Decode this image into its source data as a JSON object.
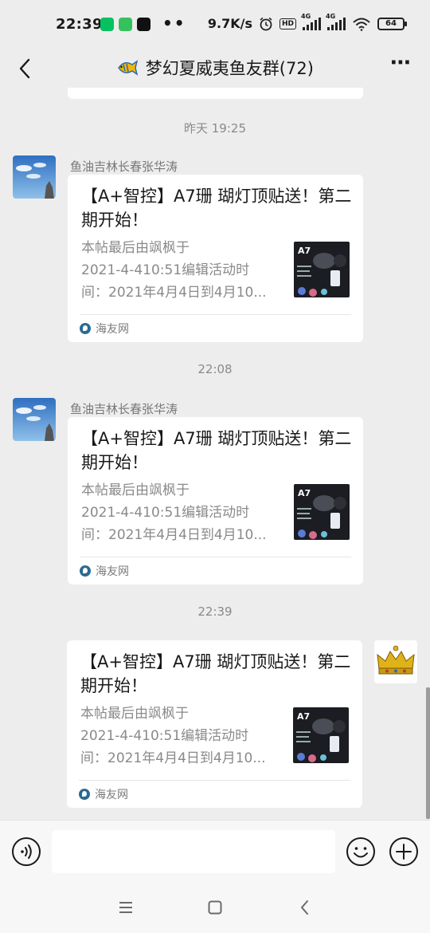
{
  "status_bar": {
    "time": "22:39",
    "dots": "••",
    "speed": "9.7K/s",
    "hd": "HD",
    "net1": "4G",
    "net2": "4G",
    "battery": "64"
  },
  "header": {
    "title": "梦幻夏威夷鱼友群(72)",
    "more": "⋯"
  },
  "messages": [
    {
      "time": "昨天 19:25",
      "sender": "鱼油吉林长春张华涛",
      "title": "【A+智控】A7珊 瑚灯顶贴送！第二期开始！",
      "desc1": "本帖最后由飒枫于",
      "desc2": "2021-4-410:51编辑活动时",
      "desc3": "间：2021年4月4日到4月10...",
      "thumb_label": "A7",
      "source": "海友网"
    },
    {
      "time": "22:08",
      "sender": "鱼油吉林长春张华涛",
      "title": "【A+智控】A7珊 瑚灯顶贴送！第二期开始！",
      "desc1": "本帖最后由飒枫于",
      "desc2": "2021-4-410:51编辑活动时",
      "desc3": "间：2021年4月4日到4月10...",
      "thumb_label": "A7",
      "source": "海友网"
    },
    {
      "time": "22:39",
      "title": "【A+智控】A7珊 瑚灯顶贴送！第二期开始！",
      "desc1": "本帖最后由飒枫于",
      "desc2": "2021-4-410:51编辑活动时",
      "desc3": "间：2021年4月4日到4月10...",
      "thumb_label": "A7",
      "source": "海友网"
    }
  ],
  "input": {
    "value": "",
    "placeholder": ""
  },
  "colors": {
    "background": "#ededed",
    "card": "#ffffff",
    "source_logo": "#2b6a93",
    "wechat_green": "#07c160"
  },
  "icons": {
    "back": "back-arrow-icon",
    "more": "more-dots-icon",
    "voice": "voice-icon",
    "emoji": "emoji-icon",
    "plus": "plus-icon",
    "nav_menu": "menu-icon",
    "nav_home": "square-icon",
    "nav_back": "back-icon"
  }
}
